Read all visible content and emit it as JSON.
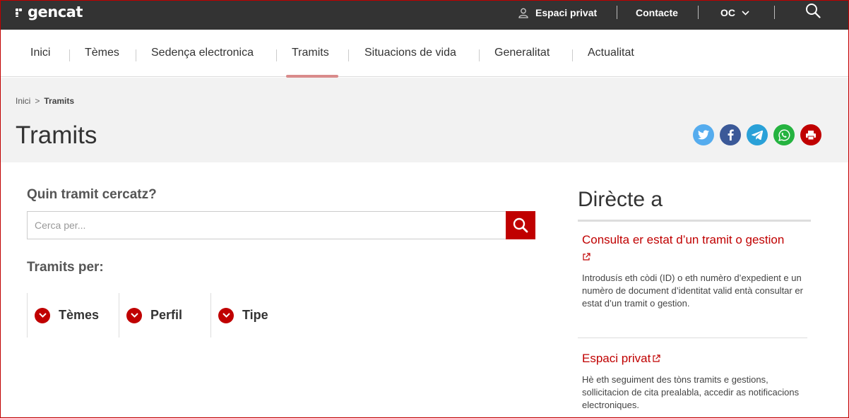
{
  "topbar": {
    "logo_text": "gencat",
    "private_label": "Espaci privat",
    "contact_label": "Contacte",
    "language_label": "OC"
  },
  "nav": {
    "items": [
      "Inici",
      "Tèmes",
      "Sedença electronica",
      "Tramits",
      "Situacions de vida",
      "Generalitat",
      "Actualitat"
    ],
    "active_index": 3
  },
  "breadcrumb": {
    "home": "Inici",
    "separator": ">",
    "current": "Tramits"
  },
  "page": {
    "title": "Tramits"
  },
  "share": {
    "buttons": [
      "twitter-icon",
      "facebook-icon",
      "telegram-icon",
      "whatsapp-icon",
      "print-icon"
    ],
    "colors": {
      "twitter": "#55acee",
      "facebook": "#3b5998",
      "telegram": "#2aa1d8",
      "whatsapp": "#25b340",
      "print": "#c00000"
    }
  },
  "search": {
    "title": "Quin tramit cercatz?",
    "placeholder": "Cerca per..."
  },
  "filters": {
    "title": "Tramits per:",
    "items": [
      "Tèmes",
      "Perfil",
      "Tipe"
    ]
  },
  "direct": {
    "title": "Dirècte a",
    "links": [
      {
        "title": "Consulta er estat d’un tramit o gestion",
        "description": "Introdusís eth còdi (ID) o eth numèro d’expedient e un numèro de document d’identitat valid entà consultar er estat d’un tramit o gestion."
      },
      {
        "title": "Espaci privat",
        "description": "Hè eth seguiment des tòns tramits e gestions, sollicitacion de cita prealabla, accedir as notificacions electroniques."
      }
    ]
  },
  "colors": {
    "accent": "#c00000",
    "topbar": "#333333",
    "header_band": "#f2f2f2"
  }
}
